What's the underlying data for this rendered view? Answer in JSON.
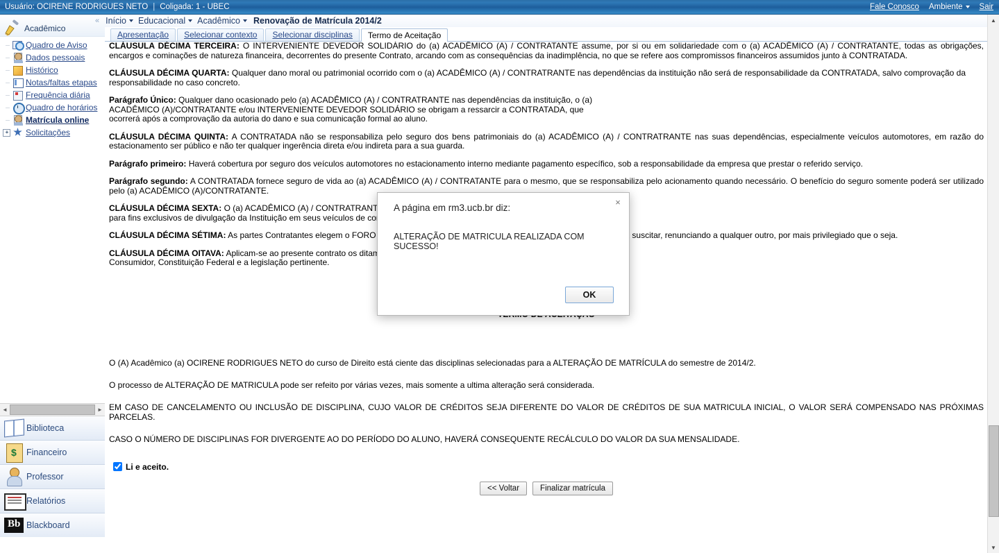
{
  "topbar": {
    "user_label": "Usuário: OCIRENE RODRIGUES NETO",
    "separator": "|",
    "coligada_label": "Coligada: 1 - UBEC",
    "contact_link": "Fale Conosco",
    "environment_menu": "Ambiente",
    "logout_link": "Sair"
  },
  "breadcrumb": {
    "collapse_icon": "«",
    "items": [
      "Início",
      "Educacional",
      "Acadêmico"
    ],
    "current": "Renovação de Matrícula 2014/2"
  },
  "tabs": [
    {
      "label": "Apresentação",
      "active": false
    },
    {
      "label": "Selecionar contexto",
      "active": false
    },
    {
      "label": "Selecionar disciplinas",
      "active": false
    },
    {
      "label": "Termo de Aceitação",
      "active": true
    }
  ],
  "sidebar": {
    "header": "Acadêmico",
    "items": [
      {
        "label": "Quadro de Aviso",
        "icon": "magnifier-board-icon",
        "bold": false,
        "expandable": false
      },
      {
        "label": "Dados pessoais",
        "icon": "person-card-icon",
        "bold": false,
        "expandable": false
      },
      {
        "label": "Histórico",
        "icon": "pencil-icon",
        "bold": false,
        "expandable": false
      },
      {
        "label": "Notas/faltas etapas",
        "icon": "list-icon",
        "bold": false,
        "expandable": false
      },
      {
        "label": "Frequência diária",
        "icon": "checklist-icon",
        "bold": false,
        "expandable": false
      },
      {
        "label": "Quadro de horários",
        "icon": "clock-icon",
        "bold": false,
        "expandable": false
      },
      {
        "label": "Matrícula online",
        "icon": "person-card-icon",
        "bold": true,
        "expandable": false
      },
      {
        "label": "Solicitações",
        "icon": "star-icon",
        "bold": false,
        "expandable": true
      }
    ],
    "modules": [
      {
        "label": "Biblioteca",
        "icon": "book-icon"
      },
      {
        "label": "Financeiro",
        "icon": "money-clipboard-icon"
      },
      {
        "label": "Professor",
        "icon": "teacher-icon"
      },
      {
        "label": "Relatórios",
        "icon": "report-icon"
      },
      {
        "label": "Blackboard",
        "icon": "blackboard-icon"
      }
    ],
    "hscroll": {
      "left_arrow": "◄",
      "right_arrow": "►"
    }
  },
  "document": {
    "clauses": [
      {
        "heading": "CLÁUSULA DÉCIMA TERCEIRA:",
        "body": "O INTERVENIENTE DEVEDOR SOLIDÁRIO do (a) ACADÊMICO (A) / CONTRATANTE assume, por si ou em solidariedade com o (a) ACADÊMICO (A) / CONTRATANTE, todas as obrigações, encargos e cominações de natureza financeira, decorrentes do presente Contrato, arcando com as consequências da inadimplência, no que se refere aos compromissos financeiros assumidos junto à CONTRATADA."
      },
      {
        "heading": "CLÁUSULA DÉCIMA QUARTA:",
        "body": "Qualquer dano moral ou patrimonial ocorrido com o (a) ACADÊMICO (A) / CONTRATRANTE nas dependências da instituição não será de responsabilidade da CONTRATADA, salvo comprovação da responsabilidade no caso concreto."
      },
      {
        "heading": "Parágrafo Único:",
        "body": "Qualquer dano ocasionado pelo (a) ACADÊMICO (A) / CONTRATRANTE nas dependências da instituição, o (a) ACADÊMICO (A)/CONTRATANTE e/ou INTERVENIENTE DEVEDOR SOLIDÁRIO se obrigam a ressarcir a CONTRATADA, que ocorrerá após a comprovação da autoria do dano e sua comunicação formal ao aluno."
      },
      {
        "heading": "CLÁUSULA DÉCIMA QUINTA:",
        "body": "A CONTRATADA não se responsabiliza pelo seguro dos bens patrimoniais do (a) ACADÊMICO (A) / CONTRATRANTE nas suas dependências, especialmente veículos automotores, em razão do estacionamento ser público e não ter qualquer ingerência direta e/ou indireta para a sua guarda."
      },
      {
        "heading": "Parágrafo primeiro:",
        "body": "Haverá cobertura por seguro dos veículos automotores no estacionamento interno mediante pagamento específico, sob a responsabilidade da empresa que prestar o referido serviço."
      },
      {
        "heading": "Parágrafo segundo:",
        "body": "A CONTRATADA fornece seguro de vida ao (a) ACADÊMICO (A) / CONTRATANTE para o mesmo, que se responsabiliza pelo acionamento quando necessário. O benefício do seguro somente poderá ser utilizado pelo (a) ACADÊMICO (A)/CONTRATANTE."
      },
      {
        "heading": "CLÁUSULA DÉCIMA SEXTA:",
        "body": "O (a) ACADÊMICO (A) / CONTRATRANTE autoriza a CONTRATADA a utilizar-se da sua imagem para fins exclusivos de divulgação da Instituição em seus veículos de comunicação (jornais, Internet, periódicos etc.)."
      },
      {
        "heading": "CLÁUSULA DÉCIMA SÉTIMA:",
        "body": "As partes Contratantes elegem o FORO da comarca para dirimir as questões que o presente Contrato possa suscitar, renunciando a qualquer outro, por mais privilegiado que o seja."
      },
      {
        "heading": "CLÁUSULA DÉCIMA OITAVA:",
        "body": "Aplicam-se ao presente contrato os ditames do Código Civil, Código de Defesa do Consumidor, Constituição Federal e a legislação pertinente."
      }
    ],
    "term_title": "TERMO DE ACEITAÇÃO",
    "term_paragraphs": [
      "O (A) Acadêmico (a) OCIRENE RODRIGUES NETO do curso de Direito está ciente das disciplinas selecionadas para a ALTERAÇÃO DE MATRÍCULA do semestre de 2014/2.",
      "O processo de ALTERAÇÃO DE MATRICULA pode ser refeito por várias vezes, mais somente a ultima alteração será considerada.",
      "EM CASO DE CANCELAMENTO OU INCLUSÃO DE DISCIPLINA, CUJO VALOR DE CRÉDITOS SEJA DIFERENTE DO VALOR DE CRÉDITOS DE SUA MATRICULA INICIAL, O VALOR SERÁ COMPENSADO NAS PRÓXIMAS PARCELAS.",
      "CASO O NÚMERO DE DISCIPLINAS FOR DIVERGENTE AO DO PERÍODO DO ALUNO, HAVERÁ CONSEQUENTE RECÁLCULO DO VALOR DA SUA MENSALIDADE."
    ],
    "accept_label": "Li e aceito.",
    "accept_checked": true,
    "back_button": "<< Voltar",
    "finish_button": "Finalizar matrícula"
  },
  "dialog": {
    "title": "A página em rm3.ucb.br diz:",
    "message": "ALTERAÇÃO DE MATRICULA REALIZADA COM SUCESSO!",
    "ok_button": "OK",
    "close_icon": "×"
  },
  "scrollbars": {
    "up_arrow": "▲",
    "down_arrow": "▼"
  },
  "colors": {
    "header_blue": "#1e5e9c",
    "link_blue": "#2a4a8a",
    "dialog_accent": "#7aa7d8"
  }
}
